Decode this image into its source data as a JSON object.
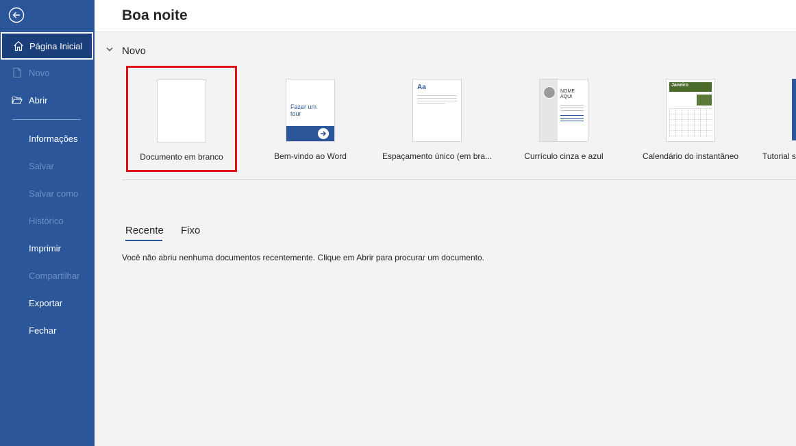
{
  "sidebar": {
    "items": [
      {
        "label": "Página Inicial"
      },
      {
        "label": "Novo"
      },
      {
        "label": "Abrir"
      },
      {
        "label": "Informações"
      },
      {
        "label": "Salvar"
      },
      {
        "label": "Salvar como"
      },
      {
        "label": "Histórico"
      },
      {
        "label": "Imprimir"
      },
      {
        "label": "Compartilhar"
      },
      {
        "label": "Exportar"
      },
      {
        "label": "Fechar"
      }
    ]
  },
  "header": {
    "greeting": "Boa noite"
  },
  "new_section": {
    "title": "Novo",
    "templates": [
      {
        "label": "Documento em branco"
      },
      {
        "label": "Bem-vindo ao Word",
        "thumb_text": "Fazer um tour"
      },
      {
        "label": "Espaçamento único (em bra...",
        "thumb_text": "Aa"
      },
      {
        "label": "Currículo cinza e azul",
        "thumb_text": "NOME AQUI"
      },
      {
        "label": "Calendário do instantâneo",
        "thumb_text": "Janeiro"
      },
      {
        "label": "Tutorial s"
      }
    ]
  },
  "recent": {
    "tabs": [
      {
        "label": "Recente"
      },
      {
        "label": "Fixo"
      }
    ],
    "empty_message": "Você não abriu nenhuma documentos recentemente. Clique em Abrir para procurar um documento."
  },
  "colors": {
    "sidebar_bg": "#2b579a",
    "highlight_border": "#e00f14"
  }
}
